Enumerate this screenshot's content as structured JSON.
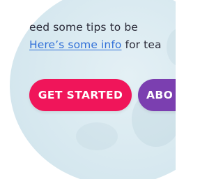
{
  "intro": {
    "line1_text": "eed some tips to be",
    "link_text": "Here’s some info",
    "line2_rest": " for tea"
  },
  "buttons": {
    "primary_label": "GET STARTED",
    "secondary_label": "ABO"
  },
  "colors": {
    "primary_button": "#f0155a",
    "secondary_button": "#7b3fb0",
    "link": "#2f6fd8",
    "background_bubble": "#d8e9f0"
  }
}
